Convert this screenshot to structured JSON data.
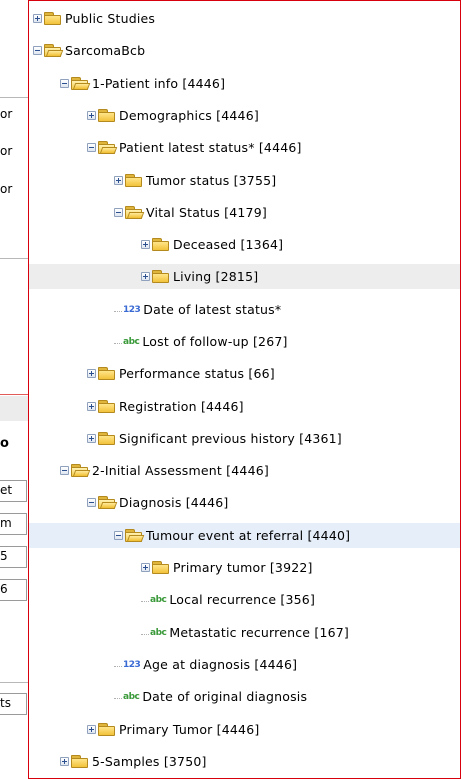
{
  "background": {
    "fragments": [
      "or",
      "or",
      "or",
      "o",
      "et",
      "m",
      "5",
      "6",
      "ts"
    ]
  },
  "tree": [
    {
      "label": "Public Studies",
      "kind": "folder",
      "state": "collapsed",
      "depth": 0
    },
    {
      "label": "SarcomaBcb",
      "kind": "folder",
      "state": "expanded",
      "depth": 0
    },
    {
      "label": "1-Patient info [4446]",
      "kind": "folder",
      "state": "expanded",
      "depth": 1
    },
    {
      "label": "Demographics [4446]",
      "kind": "folder",
      "state": "collapsed",
      "depth": 2
    },
    {
      "label": "Patient latest status* [4446]",
      "kind": "folder",
      "state": "expanded",
      "depth": 2
    },
    {
      "label": "Tumor status [3755]",
      "kind": "folder",
      "state": "collapsed",
      "depth": 3
    },
    {
      "label": "Vital Status [4179]",
      "kind": "folder",
      "state": "expanded",
      "depth": 3
    },
    {
      "label": "Deceased [1364]",
      "kind": "folder",
      "state": "collapsed",
      "depth": 4
    },
    {
      "label": "Living [2815]",
      "kind": "folder",
      "state": "collapsed",
      "depth": 4,
      "highlight": "hover"
    },
    {
      "label": "Date of latest status*",
      "kind": "numeric",
      "type_badge": "123",
      "depth": 3
    },
    {
      "label": "Lost of follow-up [267]",
      "kind": "text",
      "type_badge": "abc",
      "depth": 3
    },
    {
      "label": "Performance status [66]",
      "kind": "folder",
      "state": "collapsed",
      "depth": 2
    },
    {
      "label": "Registration [4446]",
      "kind": "folder",
      "state": "collapsed",
      "depth": 2
    },
    {
      "label": "Significant previous history [4361]",
      "kind": "folder",
      "state": "collapsed",
      "depth": 2
    },
    {
      "label": "2-Initial Assessment [4446]",
      "kind": "folder",
      "state": "expanded",
      "depth": 1
    },
    {
      "label": "Diagnosis [4446]",
      "kind": "folder",
      "state": "expanded",
      "depth": 2
    },
    {
      "label": "Tumour event at referral [4440]",
      "kind": "folder",
      "state": "expanded",
      "depth": 3,
      "highlight": "selected"
    },
    {
      "label": "Primary tumor [3922]",
      "kind": "folder",
      "state": "collapsed",
      "depth": 4
    },
    {
      "label": "Local recurrence [356]",
      "kind": "text",
      "type_badge": "abc",
      "depth": 4
    },
    {
      "label": "Metastatic recurrence [167]",
      "kind": "text",
      "type_badge": "abc",
      "depth": 4
    },
    {
      "label": "Age at diagnosis [4446]",
      "kind": "numeric",
      "type_badge": "123",
      "depth": 3
    },
    {
      "label": "Date of original diagnosis",
      "kind": "text",
      "type_badge": "abc",
      "depth": 3
    },
    {
      "label": "Primary Tumor [4446]",
      "kind": "folder",
      "state": "collapsed",
      "depth": 2
    },
    {
      "label": "5-Samples [3750]",
      "kind": "folder",
      "state": "collapsed",
      "depth": 1
    }
  ]
}
